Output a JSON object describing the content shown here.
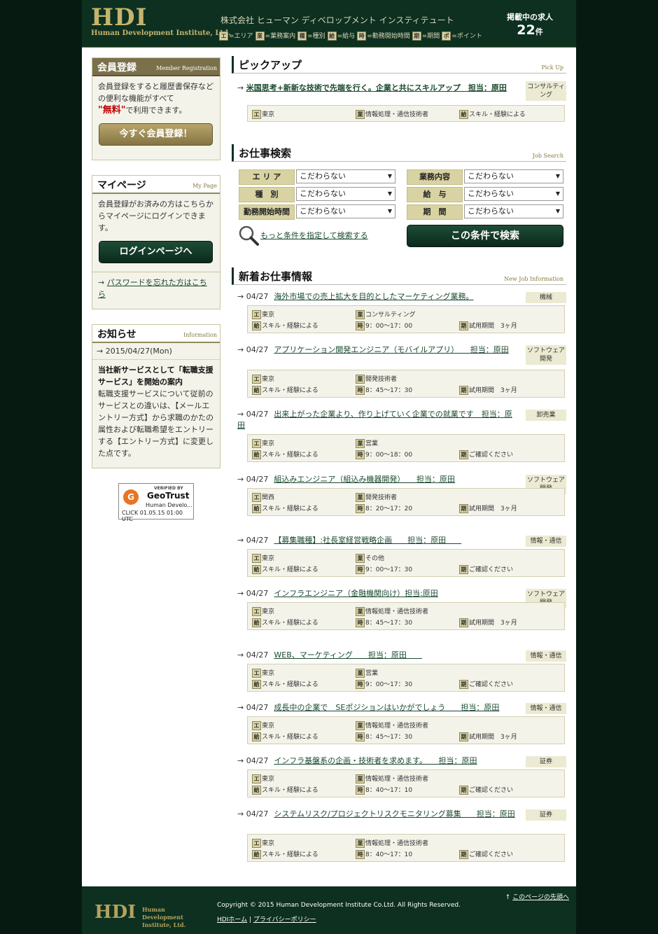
{
  "header": {
    "logo_big": "HDI",
    "logo_small": "Human Development Institute, Ltd.",
    "company": "株式会社 ヒューマン ディベロップメント インスティテュート",
    "legend": [
      {
        "icon": "エ",
        "label": "=エリア"
      },
      {
        "icon": "業",
        "label": "=業務案内"
      },
      {
        "icon": "種",
        "label": "=種別"
      },
      {
        "icon": "給",
        "label": "=給与"
      },
      {
        "icon": "時",
        "label": "=勤務開始時間"
      },
      {
        "icon": "期",
        "label": "=期間"
      },
      {
        "icon": "ポ",
        "label": "=ポイント"
      }
    ],
    "job_count_label": "掲載中の求人",
    "job_count": "22",
    "job_count_unit": "件"
  },
  "sidebar": {
    "register": {
      "title": "会員登録",
      "subtitle": "Member Registration",
      "text1": "会員登録をすると履歴書保存などの便利な機能がすべて",
      "free": "\"無料\"",
      "text2": "で利用できます。",
      "button": "今すぐ会員登録！"
    },
    "mypage": {
      "title": "マイページ",
      "subtitle": "My Page",
      "text": "会員登録がお済みの方はこちらからマイページにログインできます。",
      "button": "ログインページへ",
      "forgot": "パスワードを忘れた方はこちら"
    },
    "news": {
      "title": "お知らせ",
      "subtitle": "Information",
      "date": "2015/04/27(Mon)",
      "headline": "当社新サービスとして「転職支援サービス」を開始の案内",
      "body": "転職支援サービスについて従前のサービスとの違いは、【メールエントリー方式】から求職のかたの属性および転職希望をエントリーする【エントリー方式】に変更した点です。"
    },
    "badge": {
      "verified": "VERIFIED BY",
      "brand": "GeoTrust",
      "name": "Human Develo...",
      "date": "CLICK 01.05.15 01:00 UTC"
    }
  },
  "pickup": {
    "title": "ピックアップ",
    "subtitle": "Pick Up",
    "link": "米国思考+新新な技術で先端を行く。企業と共にスキルアップ　担当：原田",
    "tag": "コンサルティング",
    "area_icon": "エ",
    "area": "東京",
    "biz_icon": "業",
    "biz": "情報処理・通信技術者",
    "pay_icon": "給",
    "pay": "スキル・経験による"
  },
  "search": {
    "title": "お仕事検索",
    "subtitle": "Job Search",
    "labels": {
      "area": "エ リ ア",
      "biz": "業務内容",
      "type": "種　別",
      "pay": "給　与",
      "start": "勤務開始時間",
      "period": "期　間"
    },
    "default_option": "こだわらない",
    "more_link": "もっと条件を指定して検索する",
    "button": "この条件で検索"
  },
  "newjobs": {
    "title": "新着お仕事情報",
    "subtitle": "New Job Information",
    "icons": {
      "area": "エ",
      "biz": "業",
      "pay": "給",
      "time": "時",
      "period": "期"
    },
    "items": [
      {
        "date": "04/27",
        "title": "海外市場での売上拡大を目的としたマーケティング業務。",
        "tag": "機械",
        "area": "東京",
        "biz": "コンサルティング",
        "pay": "スキル・経験による",
        "time": "9：00〜17：00",
        "period": "試用期間　3ヶ月"
      },
      {
        "date": "04/27",
        "title": "アプリケーション開発エンジニア（モバイルアプリ）　　担当：原田",
        "tag": "ソフトウェア開発",
        "area": "東京",
        "biz": "開発技術者",
        "pay": "スキル・経験による",
        "time": "8：45〜17：30",
        "period": "試用期間　3ヶ月"
      },
      {
        "date": "04/27",
        "title": "出来上がった企業より、作り上げていく企業での就業です　担当：原田",
        "tag": "卸売業",
        "area": "東京",
        "biz": "営業",
        "pay": "スキル・経験による",
        "time": "9：00〜18：00",
        "period": "ご確認ください"
      },
      {
        "date": "04/27",
        "title": "組込みエンジニア（組込み機器開発）　　担当：原田",
        "tag": "ソフトウェア開発",
        "area": "関西",
        "biz": "開発技術者",
        "pay": "スキル・経験による",
        "time": "8：20〜17：20",
        "period": "試用期間　3ヶ月"
      },
      {
        "date": "04/27",
        "title": "【募集職種】:社長室経営戦略企画　　担当：原田　　",
        "tag": "情報・通信",
        "area": "東京",
        "biz": "その他",
        "pay": "スキル・経験による",
        "time": "9：00〜17：30",
        "period": "ご確認ください"
      },
      {
        "date": "04/27",
        "title": "インフラエンジニア（金融機関向け）担当:原田",
        "tag": "ソフトウェア開発",
        "area": "東京",
        "biz": "情報処理・通信技術者",
        "pay": "スキル・経験による",
        "time": "8：45〜17：30",
        "period": "試用期間　3ヶ月"
      },
      {
        "date": "04/27",
        "title": "WEB、マーケティング　　担当：原田　　",
        "tag": "情報・通信",
        "area": "東京",
        "biz": "営業",
        "pay": "スキル・経験による",
        "time": "9：00〜17：30",
        "period": "ご確認ください"
      },
      {
        "date": "04/27",
        "title": "成長中の企業で　SEポジションはいかがでしょう　　担当：原田",
        "tag": "情報・通信",
        "area": "東京",
        "biz": "情報処理・通信技術者",
        "pay": "スキル・経験による",
        "time": "8：45〜17：30",
        "period": "試用期間　3ヶ月"
      },
      {
        "date": "04/27",
        "title": "インフラ基盤系の企画・技術者を求めます。　　担当：原田",
        "tag": "証券",
        "area": "東京",
        "biz": "情報処理・通信技術者",
        "pay": "スキル・経験による",
        "time": "8：40〜17：10",
        "period": "ご確認ください"
      },
      {
        "date": "04/27",
        "title": "システムリスク/プロジェクトリスクモニタリング募集　　担当：原田",
        "tag": "証券",
        "area": "東京",
        "biz": "情報処理・通信技術者",
        "pay": "スキル・経験による",
        "time": "8：40〜17：10",
        "period": "ご確認ください"
      }
    ]
  },
  "footer": {
    "logo_big": "HDI",
    "logo_small": "Human Development Institute, Ltd.",
    "copyright": "Copyright © 2015 Human Development Institute Co.Ltd. All Rights Reserved.",
    "home": "HDIホーム",
    "privacy": "プライバシーポリシー",
    "top": "このページの先頭へ"
  }
}
